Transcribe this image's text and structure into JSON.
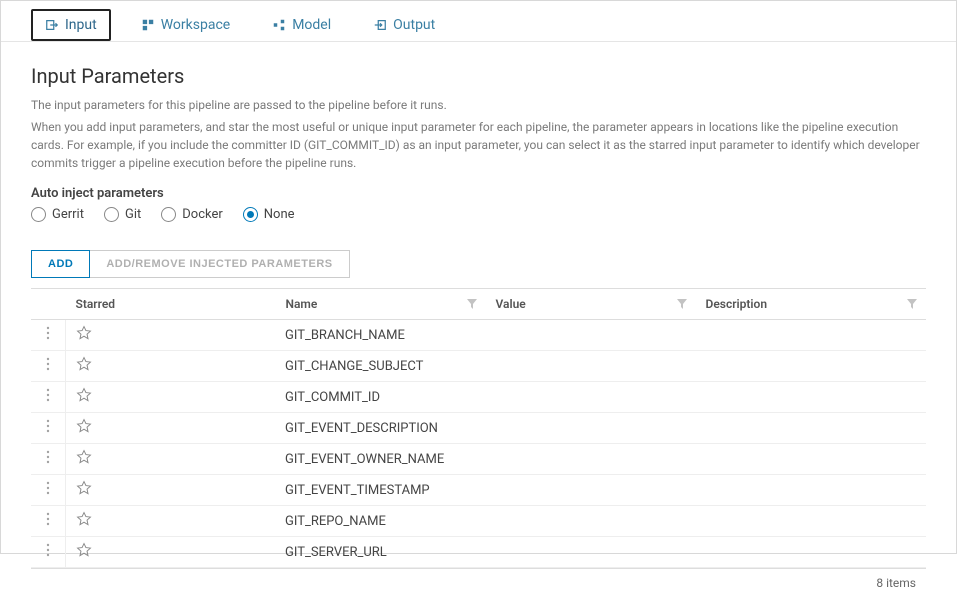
{
  "tabs": [
    {
      "label": "Input",
      "active": true
    },
    {
      "label": "Workspace",
      "active": false
    },
    {
      "label": "Model",
      "active": false
    },
    {
      "label": "Output",
      "active": false
    }
  ],
  "page": {
    "title": "Input Parameters",
    "desc1": "The input parameters for this pipeline are passed to the pipeline before it runs.",
    "desc2": "When you add input parameters, and star the most useful or unique input parameter for each pipeline, the parameter appears in locations like the pipeline execution cards. For example, if you include the committer ID (GIT_COMMIT_ID) as an input parameter, you can select it as the starred input parameter to identify which developer commits trigger a pipeline execution before the pipeline runs."
  },
  "inject": {
    "label": "Auto inject parameters",
    "options": [
      "Gerrit",
      "Git",
      "Docker",
      "None"
    ],
    "selected": "None"
  },
  "buttons": {
    "add": "ADD",
    "addremove": "ADD/REMOVE INJECTED PARAMETERS"
  },
  "columns": {
    "starred": "Starred",
    "name": "Name",
    "value": "Value",
    "description": "Description"
  },
  "rows": [
    {
      "name": "GIT_BRANCH_NAME",
      "value": "",
      "description": ""
    },
    {
      "name": "GIT_CHANGE_SUBJECT",
      "value": "",
      "description": ""
    },
    {
      "name": "GIT_COMMIT_ID",
      "value": "",
      "description": ""
    },
    {
      "name": "GIT_EVENT_DESCRIPTION",
      "value": "",
      "description": ""
    },
    {
      "name": "GIT_EVENT_OWNER_NAME",
      "value": "",
      "description": ""
    },
    {
      "name": "GIT_EVENT_TIMESTAMP",
      "value": "",
      "description": ""
    },
    {
      "name": "GIT_REPO_NAME",
      "value": "",
      "description": ""
    },
    {
      "name": "GIT_SERVER_URL",
      "value": "",
      "description": ""
    }
  ],
  "footer": "8 items"
}
